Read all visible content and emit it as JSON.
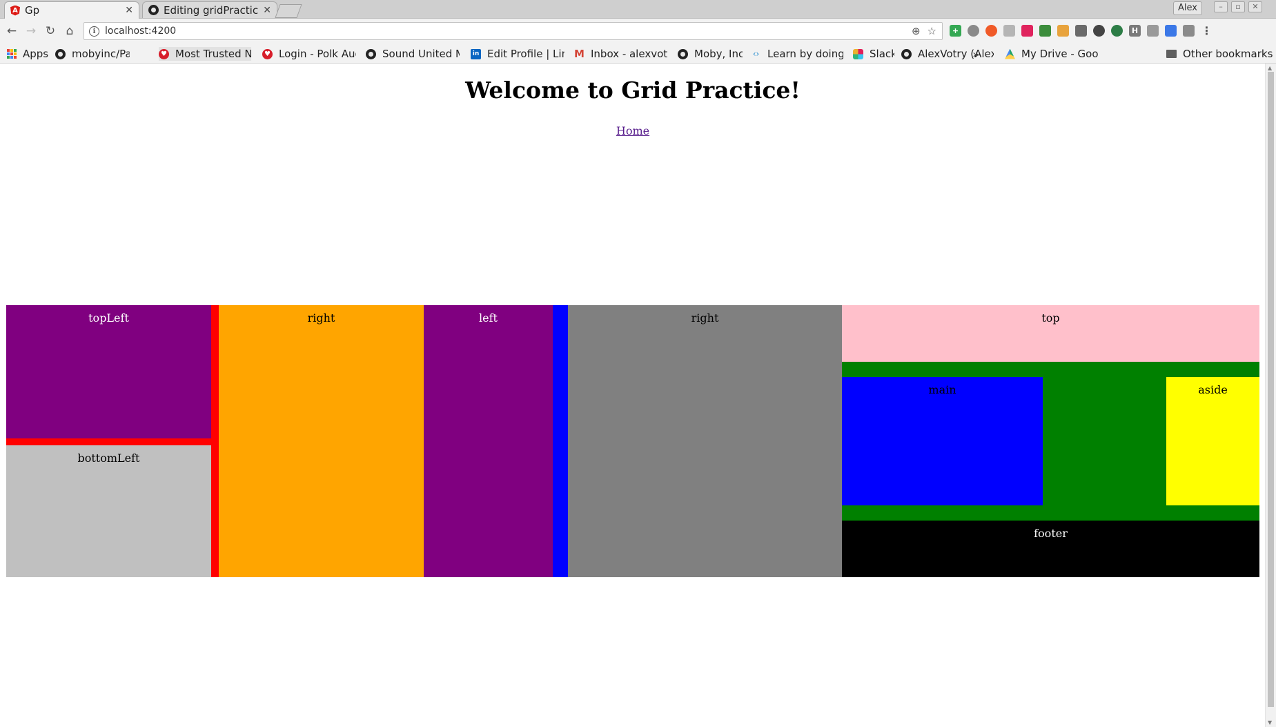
{
  "browser": {
    "tabs": [
      {
        "title": "Gp",
        "icon": "angular-icon",
        "active": true
      },
      {
        "title": "Editing gridPractice",
        "icon": "github-icon",
        "active": false
      }
    ],
    "profile_name": "Alex",
    "window_controls": {
      "minimize": "–",
      "restore": "▫",
      "close": "✕"
    },
    "nav": {
      "back": "←",
      "forward": "→",
      "reload": "↻",
      "home": "⌂"
    },
    "address": {
      "url": "localhost:4200",
      "info_glyph": "i",
      "zoom_glyph": "⊕",
      "star_glyph": "☆"
    },
    "bookmarks": [
      {
        "label": "Apps",
        "icon": "apps-icon"
      },
      {
        "label": "mobyinc/Pasadena",
        "icon": "github-icon"
      },
      {
        "label": "Most Trusted Na",
        "icon": "heart-icon"
      },
      {
        "label": "Login - Polk Aud",
        "icon": "heart-icon"
      },
      {
        "label": "Sound United M",
        "icon": "github-icon"
      },
      {
        "label": "Edit Profile | Link",
        "icon": "linkedin-icon"
      },
      {
        "label": "Inbox - alexvotry",
        "icon": "gmail-icon"
      },
      {
        "label": "Moby, Inc.",
        "icon": "github-icon"
      },
      {
        "label": "Learn by doing |",
        "icon": "code-icon"
      },
      {
        "label": "Slack",
        "icon": "slack-icon"
      },
      {
        "label": "AlexVotry (Alex V",
        "icon": "github-icon"
      },
      {
        "label": "My Drive - Googl",
        "icon": "drive-icon"
      }
    ],
    "bookmarks_more": "»",
    "other_bookmarks": "Other bookmarks"
  },
  "page": {
    "title": "Welcome to Grid Practice!",
    "home_link": "Home"
  },
  "grid_cells": {
    "topLeft": "topLeft",
    "bottomLeft": "bottomLeft",
    "right1": "right",
    "left": "left",
    "right2": "right",
    "top": "top",
    "main": "main",
    "aside": "aside",
    "footer": "footer"
  },
  "colors": {
    "purple": "#800080",
    "red": "#ff0000",
    "silver": "#c0c0c0",
    "orange": "#ffa500",
    "blue": "#0000ff",
    "gray": "#808080",
    "pink": "#ffc0cb",
    "green": "#008000",
    "yellow": "#ffff00",
    "black": "#000000"
  }
}
